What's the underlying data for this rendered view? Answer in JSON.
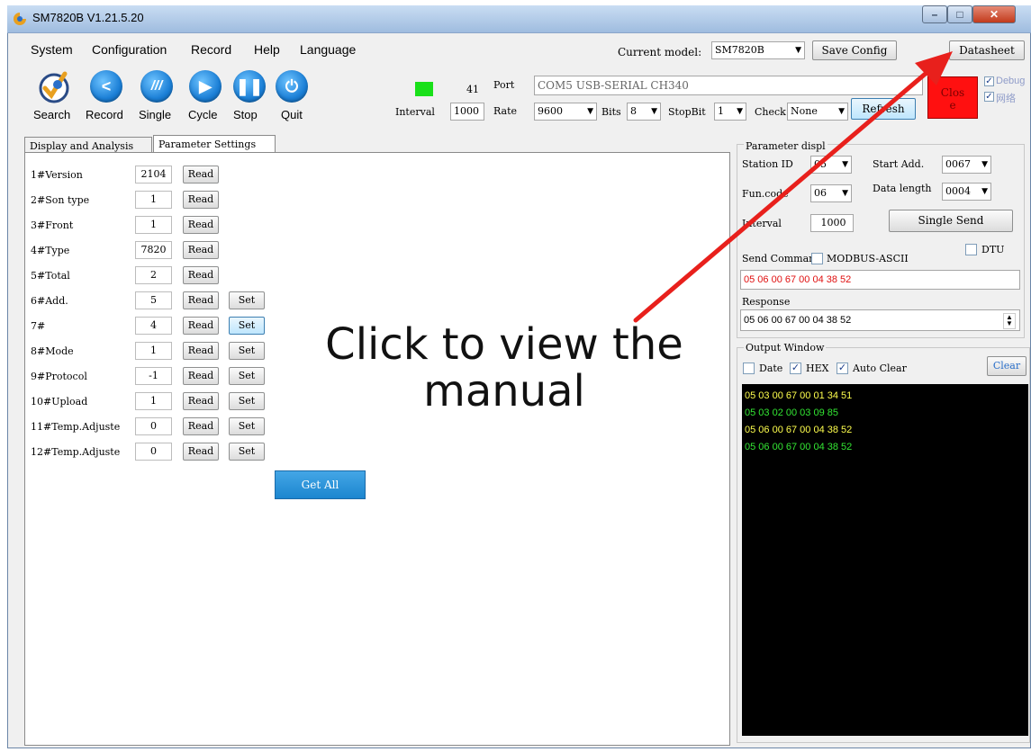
{
  "window": {
    "title": "SM7820B   V1.21.5.20",
    "min": "–",
    "max": "□",
    "close": "✕"
  },
  "menu": [
    "System",
    "Configuration",
    "Record",
    "Help",
    "Language"
  ],
  "model": {
    "label": "Current model:",
    "value": "SM7820B",
    "save_config": "Save Config",
    "datasheet": "Datasheet"
  },
  "toolbar": [
    {
      "label": "Search",
      "icon": "search-logo-icon"
    },
    {
      "label": "Record",
      "icon": "share-icon"
    },
    {
      "label": "Single",
      "icon": "single-icon"
    },
    {
      "label": "Cycle",
      "icon": "play-icon"
    },
    {
      "label": "Stop",
      "icon": "pause-icon"
    },
    {
      "label": "Quit",
      "icon": "power-icon"
    }
  ],
  "serial": {
    "count": "41",
    "interval_label": "Interval",
    "interval_value": "1000",
    "port_label": "Port",
    "port_value": "COM5 USB-SERIAL CH340",
    "rate_label": "Rate",
    "rate_value": "9600",
    "bits_label": "Bits",
    "bits_value": "8",
    "stopbit_label": "StopBit",
    "stopbit_value": "1",
    "check_label": "Check",
    "check_value": "None",
    "refresh": "Refresh",
    "close": "Clos\ne",
    "debug_label": "Debug",
    "network_label": "网络",
    "status_color": "#19e019",
    "close_color": "#ff1010"
  },
  "tabs": [
    "Display and Analysis",
    "Parameter Settings"
  ],
  "params": [
    {
      "label": "1#Version",
      "value": "2104",
      "set": false
    },
    {
      "label": "2#Son type",
      "value": "1",
      "set": false
    },
    {
      "label": "3#Front",
      "value": "1",
      "set": false
    },
    {
      "label": "4#Type",
      "value": "7820",
      "set": false
    },
    {
      "label": "5#Total",
      "value": "2",
      "set": false
    },
    {
      "label": "6#Add.",
      "value": "5",
      "set": true
    },
    {
      "label": "7#",
      "value": "4",
      "set": true
    },
    {
      "label": "8#Mode",
      "value": "1",
      "set": true
    },
    {
      "label": "9#Protocol",
      "value": "-1",
      "set": true
    },
    {
      "label": "10#Upload",
      "value": "1",
      "set": true
    },
    {
      "label": "11#Temp.Adjuste",
      "value": "0",
      "set": true
    },
    {
      "label": "12#Temp.Adjuste",
      "value": "0",
      "set": true
    }
  ],
  "param_buttons": {
    "read": "Read",
    "set": "Set",
    "get_all": "Get All"
  },
  "overlay": {
    "line1": "Click to view the",
    "line2": "manual"
  },
  "right": {
    "param_display_title": "Parameter displ",
    "station_id_label": "Station ID",
    "station_id_value": "05",
    "start_add_label": "Start Add.",
    "start_add_value": "0067",
    "fun_code_label": "Fun.code",
    "fun_code_value": "06",
    "data_length_label": "Data length",
    "data_length_value": "0004",
    "interval_label": "Interval",
    "interval_value": "1000",
    "single_send": "Single Send",
    "send_command_label": "Send Comman",
    "modbus_ascii_label": "MODBUS-ASCII",
    "dtu_label": "DTU",
    "send_command_value": "05 06 00 67 00 04 38 52",
    "response_label": "Response",
    "response_value": "05 06 00 67 00 04 38 52",
    "output_window_label": "Output Window",
    "date_label": "Date",
    "hex_label": "HEX",
    "auto_clear_label": "Auto Clear",
    "clear": "Clear",
    "output_lines": [
      {
        "text": "05 03 00 67 00 01 34 51",
        "color": "#ffff4d"
      },
      {
        "text": "05 03 02 00 03 09 85",
        "color": "#33e633"
      },
      {
        "text": "05 06 00 67 00 04 38 52",
        "color": "#ffff4d"
      },
      {
        "text": "05 06 00 67 00 04 38 52",
        "color": "#33e633"
      }
    ]
  },
  "colors": {
    "arrow": "#e8201c",
    "send_text": "#e01010"
  }
}
